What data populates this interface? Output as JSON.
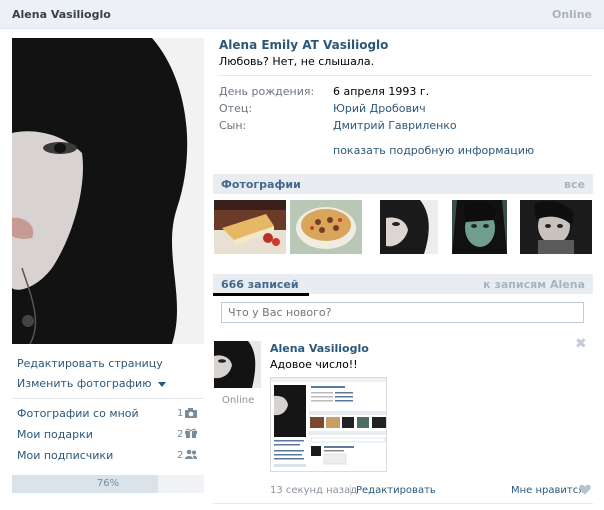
{
  "header": {
    "name": "Alena Vasilioglo",
    "status": "Online"
  },
  "sidebar": {
    "edit_page": "Редактировать страницу",
    "change_photo": "Изменить фотографию",
    "items": [
      {
        "label": "Фотографии со мной",
        "count": "1",
        "icon": "camera-icon"
      },
      {
        "label": "Мои подарки",
        "count": "2",
        "icon": "gift-icon"
      },
      {
        "label": "Мои подписчики",
        "count": "2",
        "icon": "people-icon"
      }
    ],
    "completion": {
      "value": 0.76,
      "label": "76%"
    }
  },
  "profile": {
    "full_name": "Alena Emily AT Vasilioglo",
    "status_text": "Любовь? Нет, не слышала.",
    "info": [
      {
        "label": "День рождения:",
        "value": "6 апреля 1993 г.",
        "link": false
      },
      {
        "label": "Отец:",
        "value": "Юрий Дробович",
        "link": true
      },
      {
        "label": "Сын:",
        "value": "Дмитрий Гавриленко",
        "link": true
      }
    ],
    "more_info": "показать подробную информацию"
  },
  "photos": {
    "title": "Фотографии",
    "all_link": "все",
    "thumbs": [
      "cake-photo",
      "pie-photo",
      "portrait-photo-1",
      "portrait-photo-2",
      "portrait-photo-3"
    ]
  },
  "wall": {
    "count_title": "666 записей",
    "to_posts_link": "к записям Alena",
    "placeholder": "Что у Вас нового?",
    "post": {
      "author": "Alena Vasilioglo",
      "online": "Online",
      "text": "Адовое число!!",
      "time": "13 секунд назад",
      "separator": "|",
      "edit": "Редактировать",
      "like": "Мне нравится",
      "close_glyph": "✖"
    }
  },
  "colors": {
    "link": "#2b587a",
    "section_bg": "#e9edf1",
    "header_bg": "#edf0f4"
  }
}
